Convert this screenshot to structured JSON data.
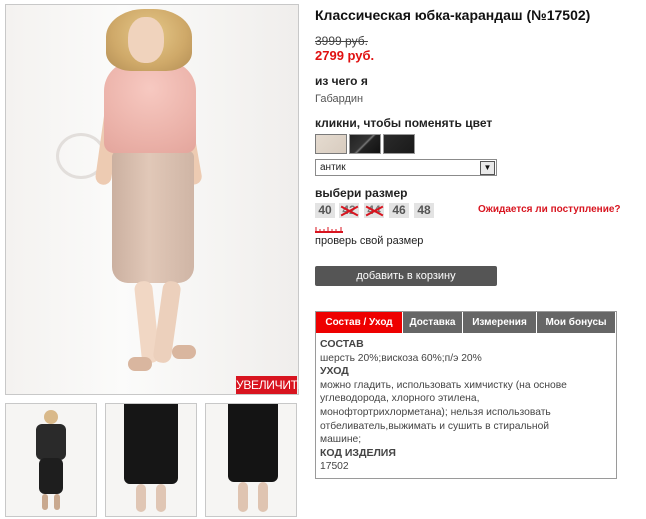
{
  "product": {
    "title": "Классическая юбка-карандаш (№17502)",
    "old_price": "3999 руб.",
    "new_price": "2799 руб."
  },
  "material": {
    "label": "из чего я",
    "value": "Габардин"
  },
  "color": {
    "label": "кликни, чтобы поменять цвет",
    "swatches": [
      "beige-swatch",
      "black-pinstripe-swatch",
      "black-swatch"
    ],
    "selected": "антик",
    "accent": "#d8141f"
  },
  "size": {
    "label": "выбери размер",
    "options": [
      {
        "value": "40",
        "available": true
      },
      {
        "value": "42",
        "available": false
      },
      {
        "value": "44",
        "available": false
      },
      {
        "value": "46",
        "available": true
      },
      {
        "value": "48",
        "available": true
      }
    ],
    "awaiting_link": "Ожидается ли поступление?",
    "check_link": "проверь свой размер"
  },
  "cart_button": "добавить в корзину",
  "zoom_button": "УВЕЛИЧИТЬ",
  "tabs": [
    {
      "label": "Состав / Уход",
      "active": true
    },
    {
      "label": "Доставка",
      "active": false
    },
    {
      "label": "Измерения",
      "active": false
    },
    {
      "label": "Мои бонусы",
      "active": false
    }
  ],
  "details": {
    "composition_heading": "СОСТАВ",
    "composition": "шерсть 20%;вискоза 60%;п/э 20%",
    "care_heading": "УХОД",
    "care_lines": [
      "можно гладить, использовать химчистку (на основе",
      "углеводорода, хлорного этилена,",
      "монофтортрихлорметана); нельзя использовать",
      "отбеливатель,выжимать и сушить в стиральной",
      "машине;"
    ],
    "code_heading": "КОД ИЗДЕЛИЯ",
    "code": "17502"
  },
  "icons": {
    "ruler": "ruler-icon",
    "dropdown": "chevron-down-icon"
  }
}
